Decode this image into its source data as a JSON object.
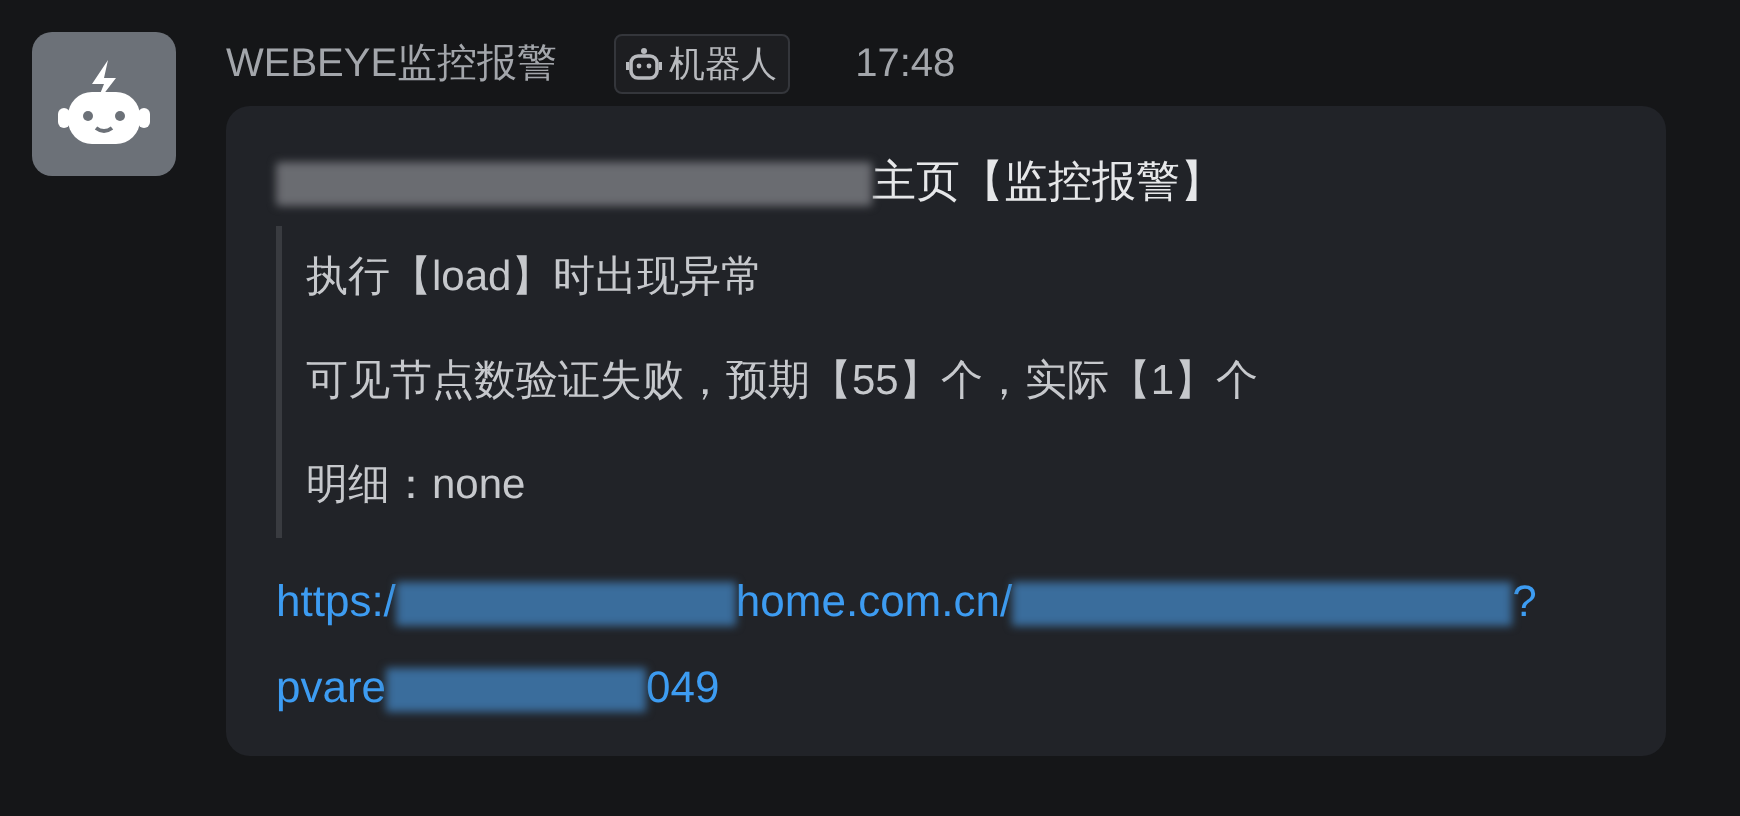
{
  "sender": {
    "name": "WEBEYE监控报警",
    "badge": "机器人",
    "time": "17:48"
  },
  "message": {
    "title": [
      {
        "kind": "redacted"
      },
      {
        "kind": "text",
        "text": "主页【监控报警】"
      }
    ],
    "quote_lines": [
      "执行【load】时出现异常",
      "可见节点数验证失败，预期【55】个，实际【1】个",
      "明细：none"
    ],
    "link": [
      {
        "kind": "text",
        "text": "https:/"
      },
      {
        "kind": "redacted"
      },
      {
        "kind": "text",
        "text": "home.com.cn/"
      },
      {
        "kind": "redacted"
      },
      {
        "kind": "text",
        "text": "?"
      },
      {
        "kind": "break"
      },
      {
        "kind": "text",
        "text": "pvare"
      },
      {
        "kind": "redacted"
      },
      {
        "kind": "text",
        "text": "049"
      }
    ]
  }
}
